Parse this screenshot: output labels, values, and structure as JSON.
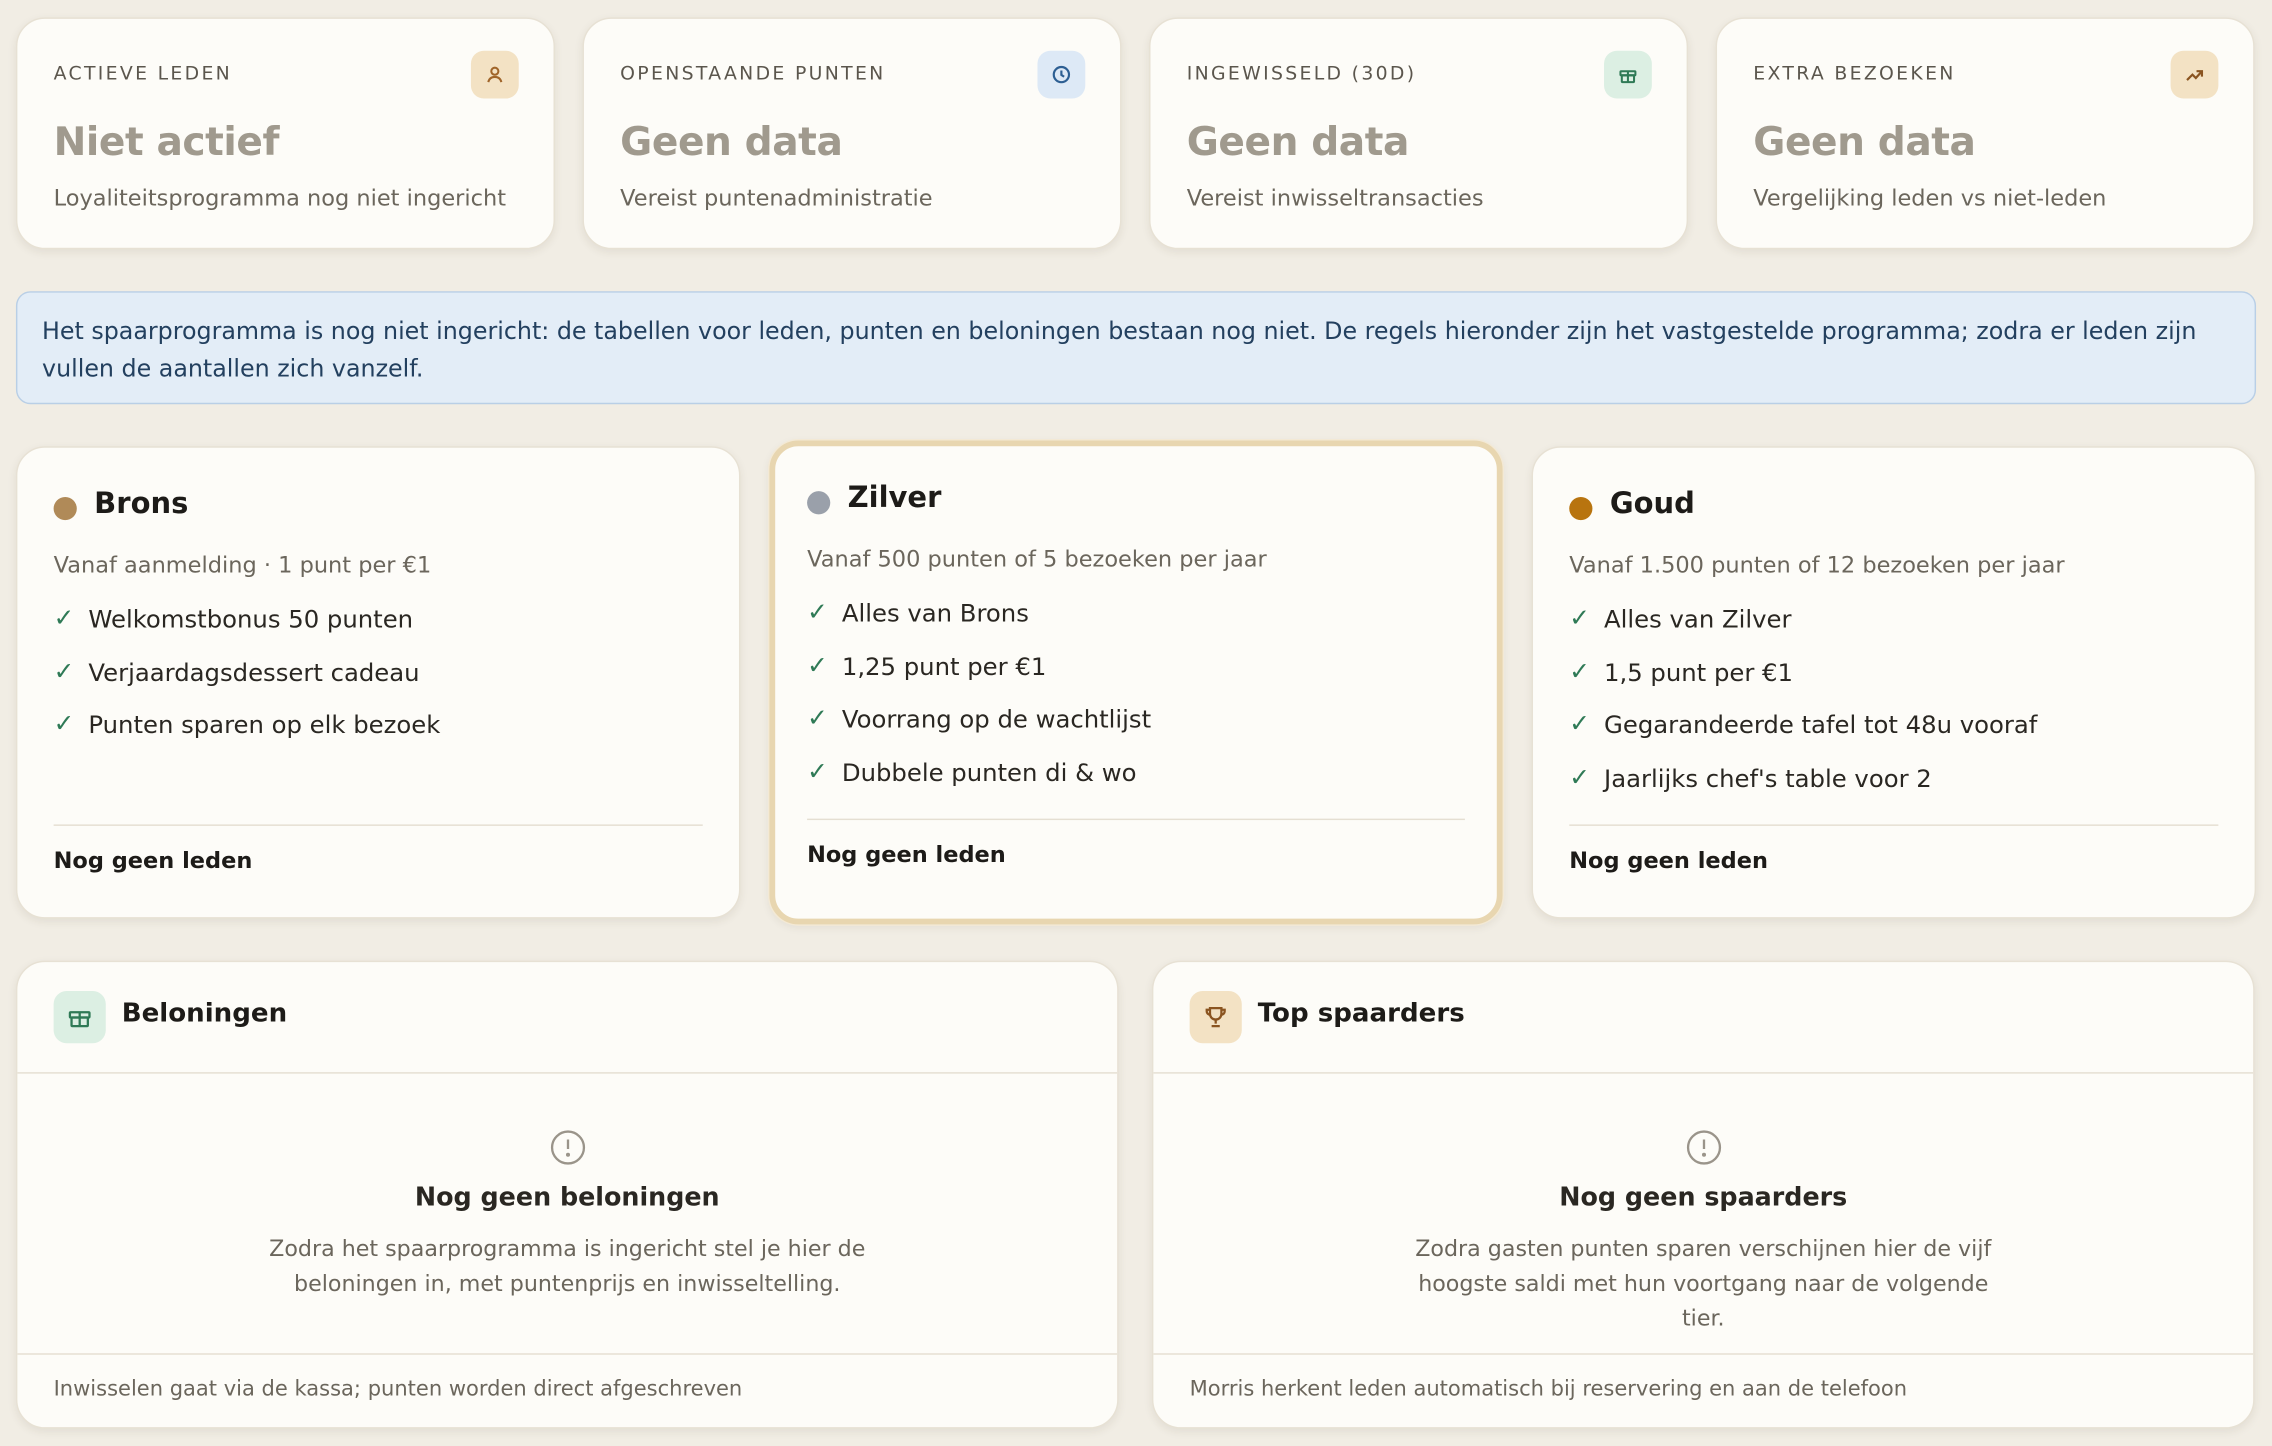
{
  "kpis": [
    {
      "label": "ACTIEVE LEDEN",
      "value": "Niet actief",
      "sub": "Loyaliteitsprogramma nog niet ingericht",
      "icon": "user-icon",
      "icon_bg": "#f3e2c4",
      "icon_color": "#a0652a"
    },
    {
      "label": "OPENSTAANDE PUNTEN",
      "value": "Geen data",
      "sub": "Vereist puntenadministratie",
      "icon": "clock-icon",
      "icon_bg": "#dde9f6",
      "icon_color": "#2d5f93"
    },
    {
      "label": "INGEWISSELD (30D)",
      "value": "Geen data",
      "sub": "Vereist inwisseltransacties",
      "icon": "gift-icon",
      "icon_bg": "#dcefe3",
      "icon_color": "#2f7a56"
    },
    {
      "label": "EXTRA BEZOEKEN",
      "value": "Geen data",
      "sub": "Vergelijking leden vs niet-leden",
      "icon": "trend-up-icon",
      "icon_bg": "#f3e2c4",
      "icon_color": "#8a5420"
    }
  ],
  "banner": {
    "text": "Het spaarprogramma is nog niet ingericht: de tabellen voor leden, punten en beloningen bestaan nog niet. De regels hieronder zijn het vastgestelde programma; zodra er leden zijn vullen de aantallen zich vanzelf."
  },
  "tiers": [
    {
      "name": "Brons",
      "dot_color": "#b08a58",
      "requirement": "Vanaf aanmelding · 1 punt per €1",
      "perks": [
        "Welkomstbonus 50 punten",
        "Verjaardagsdessert cadeau",
        "Punten sparen op elk bezoek"
      ],
      "members": "Nog geen leden"
    },
    {
      "name": "Zilver",
      "dot_color": "#9aa0aa",
      "requirement": "Vanaf 500 punten of 5 bezoeken per jaar",
      "perks": [
        "Alles van Brons",
        "1,25 punt per €1",
        "Voorrang op de wachtlijst",
        "Dubbele punten di & wo"
      ],
      "members": "Nog geen leden"
    },
    {
      "name": "Goud",
      "dot_color": "#b8740f",
      "requirement": "Vanaf 1.500 punten of 12 bezoeken per jaar",
      "perks": [
        "Alles van Zilver",
        "1,5 punt per €1",
        "Gegarandeerde tafel tot 48u vooraf",
        "Jaarlijks chef's table voor 2"
      ],
      "members": "Nog geen leden"
    }
  ],
  "check_glyph": "✓",
  "rewards": {
    "title": "Beloningen",
    "icon": "gift-icon",
    "empty_icon": "alert-circle-icon",
    "empty_title": "Nog geen beloningen",
    "empty_text": "Zodra het spaarprogramma is ingericht stel je hier de beloningen in, met puntenprijs en inwisseltelling.",
    "footer": "Inwisselen gaat via de kassa; punten worden direct afgeschreven"
  },
  "top_savers": {
    "title": "Top spaarders",
    "icon": "trophy-icon",
    "empty_icon": "alert-circle-icon",
    "empty_title": "Nog geen spaarders",
    "empty_text": "Zodra gasten punten sparen verschijnen hier de vijf hoogste saldi met hun voortgang naar de volgende tier.",
    "footer": "Morris herkent leden automatisch bij reservering en aan de telefoon"
  }
}
